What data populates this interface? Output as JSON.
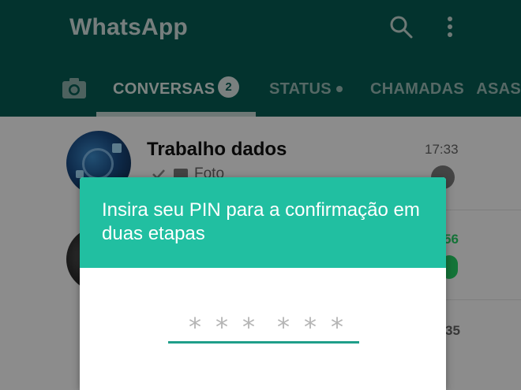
{
  "appbar": {
    "title": "WhatsApp",
    "icons": [
      "search-icon",
      "more-vert-icon"
    ],
    "color": "#075e54"
  },
  "tabs": {
    "camera_icon": "camera-icon",
    "conversas": "CONVERSAS",
    "conversas_badge": "2",
    "status": "STATUS",
    "chamadas": "CHAMADAS",
    "extra": "DASAS"
  },
  "chats": [
    {
      "name": "Trabalho dados",
      "time": "17:33",
      "preview": "Foto"
    },
    {
      "name": "",
      "time": "56",
      "preview": ""
    },
    {
      "name": "",
      "time": "35",
      "preview": ""
    }
  ],
  "dialog": {
    "title": "Insira seu PIN para a confirmação em duas etapas",
    "pin_group_1": "***",
    "pin_group_2": "***",
    "header_color": "#21bfa1"
  }
}
